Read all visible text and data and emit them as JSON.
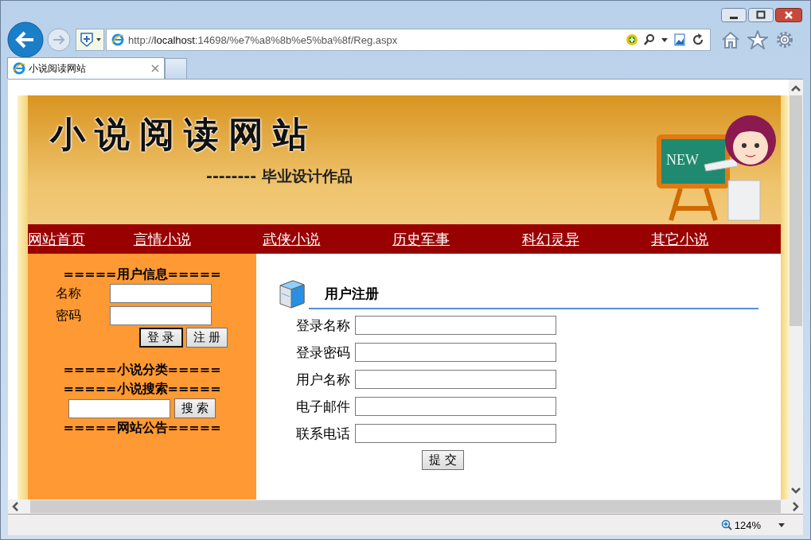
{
  "browser": {
    "address": "http://**localhost**:14698/%e7%a8%8b%e5%ba%8f/Reg.aspx",
    "tab_title": "小说阅读网站",
    "zoom": "124%"
  },
  "banner": {
    "title": "小说阅读网站",
    "subtitle": "-------- 毕业设计作品",
    "board_text": "NEW"
  },
  "nav": [
    "网站首页",
    "言情小说",
    "武侠小说",
    "历史军事",
    "科幻灵异",
    "其它小说"
  ],
  "sidebar": {
    "user_heading": "=====用户信息=====",
    "fields": [
      {
        "label": "名称"
      },
      {
        "label": "密码"
      }
    ],
    "buttons": [
      "登 录",
      "注 册"
    ],
    "category_heading": "=====小说分类=====",
    "search_heading": "=====小说搜索=====",
    "search_button": "搜 索",
    "notice_heading": "=====网站公告====="
  },
  "register": {
    "title": "用户注册",
    "fields": [
      "登录名称",
      "登录密码",
      "用户名称",
      "电子邮件",
      "联系电话"
    ],
    "submit": "提 交"
  }
}
